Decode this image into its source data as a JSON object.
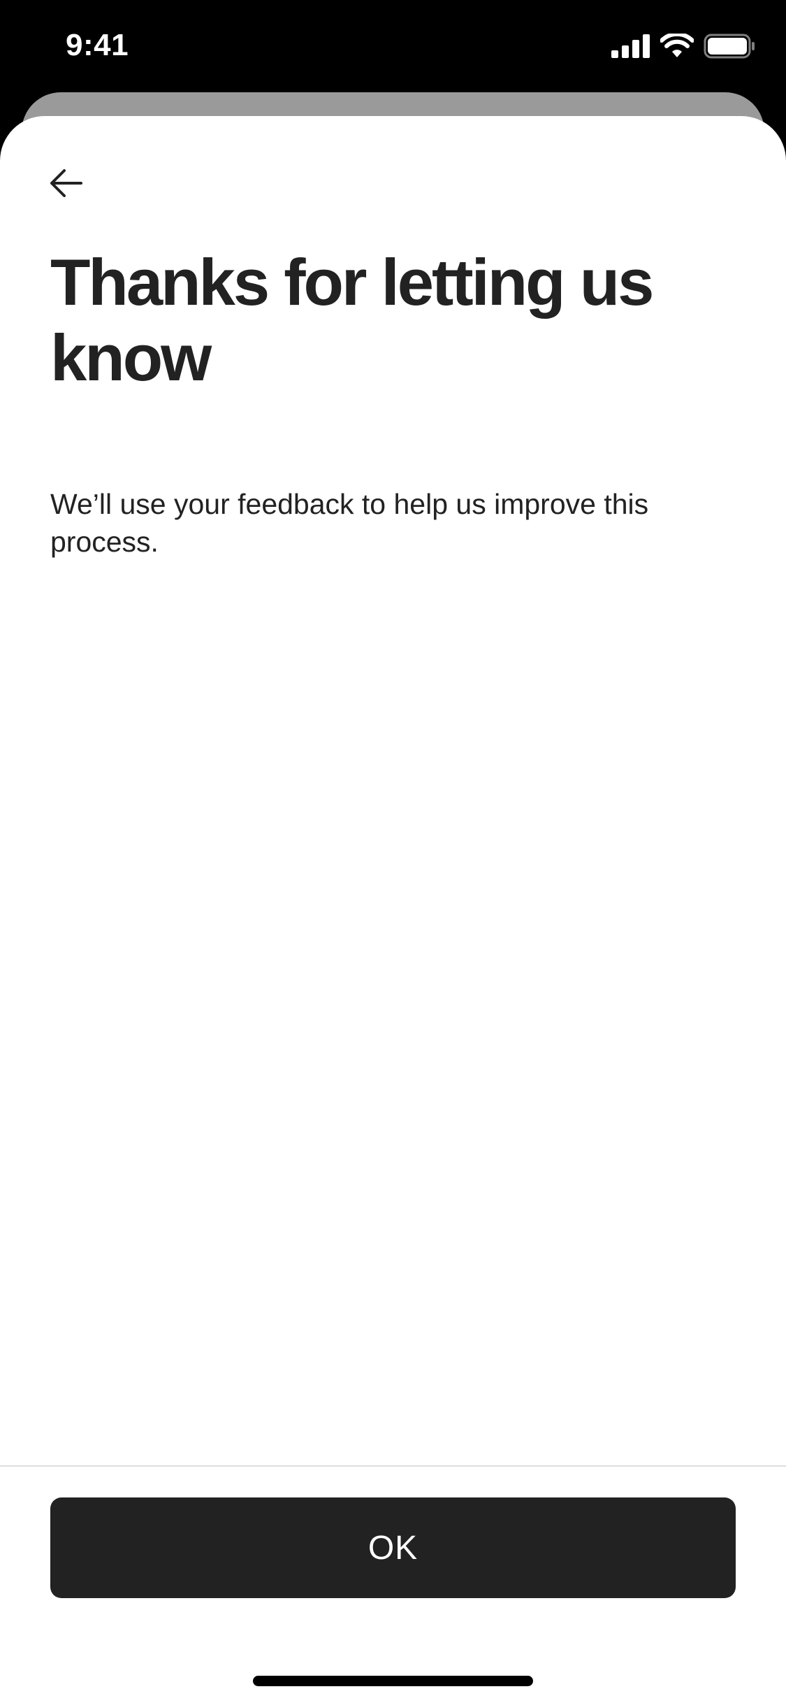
{
  "status_bar": {
    "time": "9:41",
    "icons": [
      "cellular-signal-icon",
      "wifi-icon",
      "battery-icon"
    ]
  },
  "header": {
    "back_icon": "arrow-left-icon"
  },
  "content": {
    "title": "Thanks for letting us know",
    "body": "We’ll use your feedback to help us improve this process."
  },
  "footer": {
    "ok_label": "OK"
  },
  "colors": {
    "text": "#222222",
    "button_bg": "#222222",
    "button_text": "#ffffff",
    "background": "#ffffff",
    "backdrop": "#000000"
  }
}
